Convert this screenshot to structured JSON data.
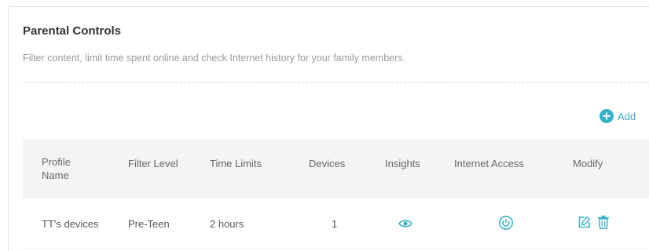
{
  "section": {
    "title": "Parental Controls",
    "description": "Filter content, limit time spent online and check Internet history for your family members."
  },
  "toolbar": {
    "add_label": "Add",
    "add_icon": "plus-circle-icon"
  },
  "table": {
    "columns": [
      "Profile Name",
      "Filter Level",
      "Time Limits",
      "Devices",
      "Insights",
      "Internet Access",
      "Modify"
    ],
    "rows": [
      {
        "profile_name": "TT's devices",
        "filter_level": "Pre-Teen",
        "time_limits": "2 hours",
        "devices": "1",
        "insights_icon": "eye-icon",
        "internet_access_icon": "power-icon",
        "modify_icons": [
          "edit-icon",
          "trash-icon"
        ]
      }
    ]
  },
  "colors": {
    "accent": "#3ab0c8",
    "header_bg": "#f4f4f4",
    "title": "#333333",
    "muted": "#9a9a9a"
  }
}
